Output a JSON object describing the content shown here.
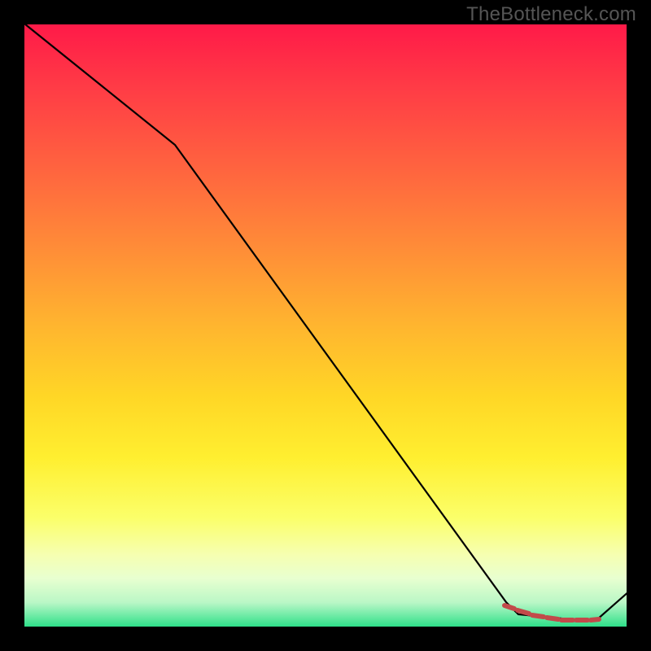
{
  "watermark": "TheBottleneck.com",
  "chart_data": {
    "type": "line",
    "title": "",
    "xlabel": "",
    "ylabel": "",
    "xlim": [
      0,
      100
    ],
    "ylim": [
      0,
      100
    ],
    "series": [
      {
        "name": "curve",
        "x": [
          0,
          25,
          80,
          82,
          92,
          95,
          100
        ],
        "values": [
          100,
          80,
          4,
          2,
          1,
          1,
          6
        ]
      }
    ],
    "markers": {
      "x": [
        80,
        82,
        84,
        86,
        88,
        90,
        92,
        94
      ],
      "values": [
        4,
        3,
        2,
        2,
        1,
        1,
        1,
        1
      ],
      "color": "#c24a4a"
    },
    "gradient_stops": [
      {
        "pos": 0.0,
        "color": "#ff1a48"
      },
      {
        "pos": 0.26,
        "color": "#ff6a3e"
      },
      {
        "pos": 0.5,
        "color": "#ffb52f"
      },
      {
        "pos": 0.72,
        "color": "#ffef30"
      },
      {
        "pos": 0.88,
        "color": "#f6ffb0"
      },
      {
        "pos": 1.0,
        "color": "#2fe08a"
      }
    ]
  }
}
